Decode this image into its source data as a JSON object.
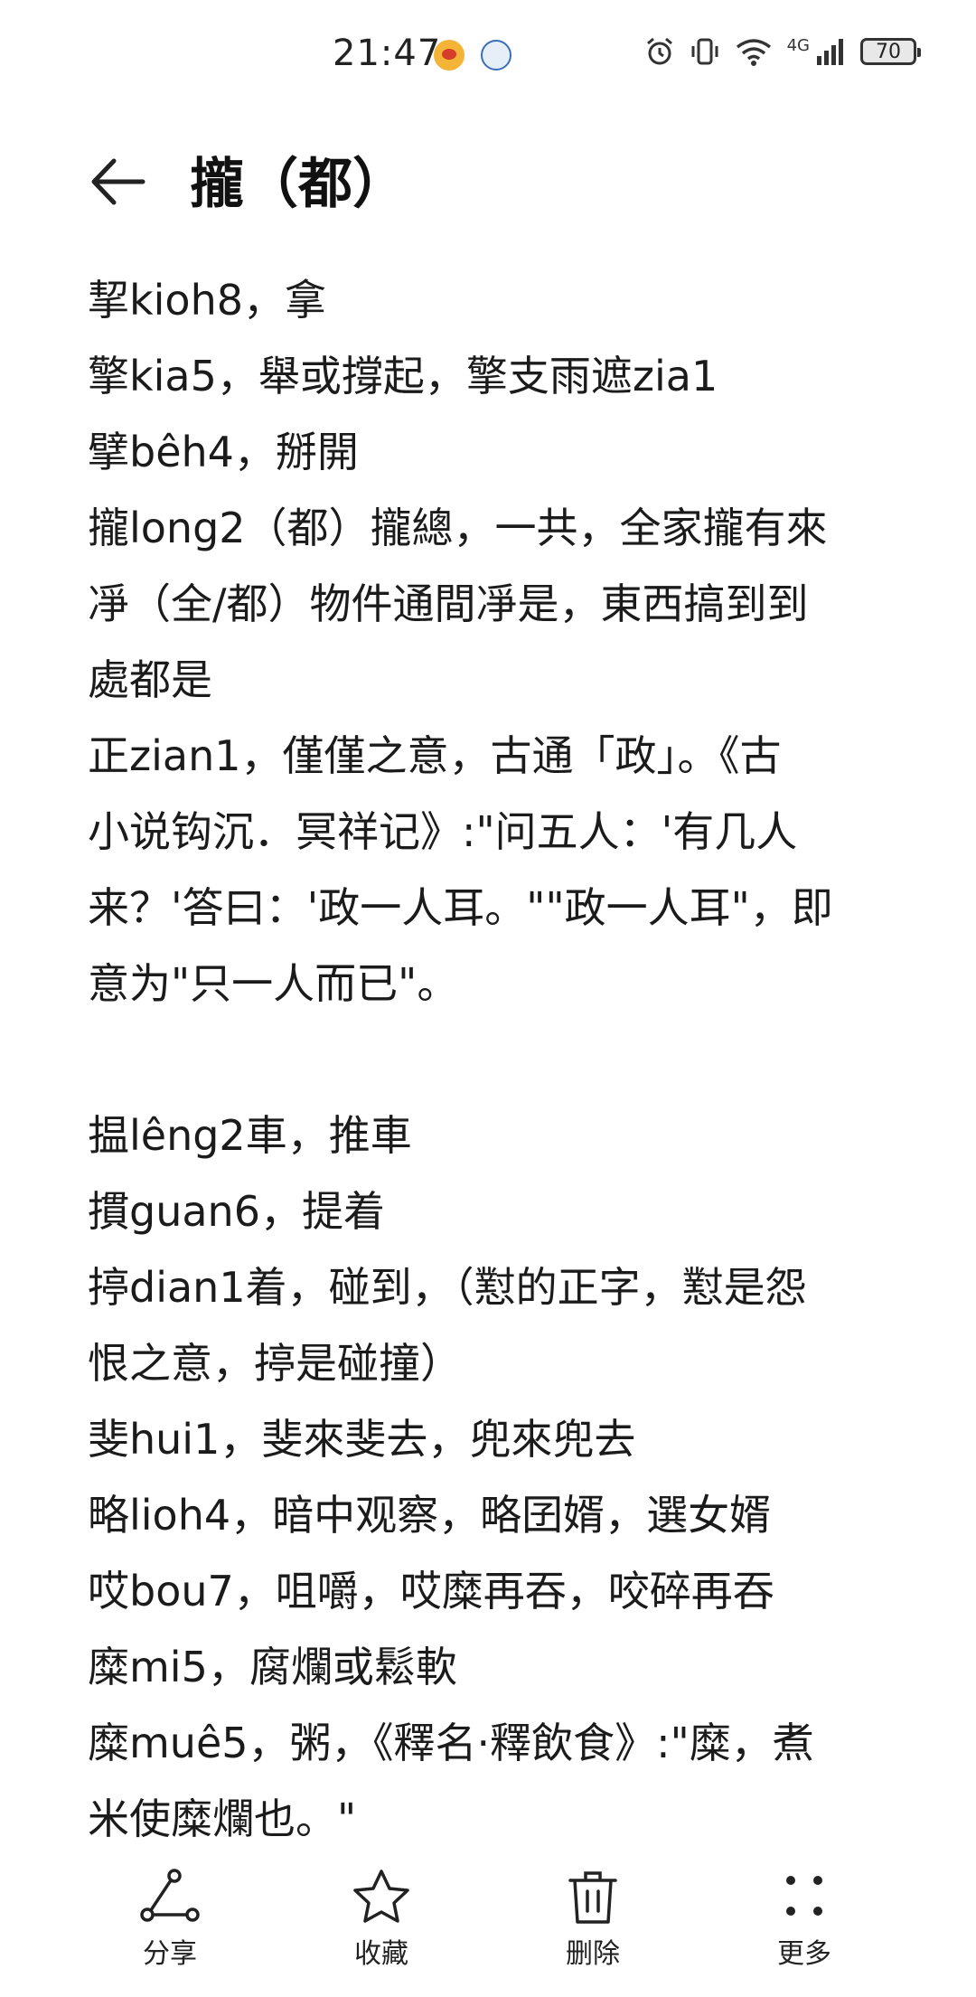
{
  "status_bar": {
    "time": "21:47",
    "battery": "70",
    "network": "4G",
    "icons": [
      "weibo-app-icon",
      "app-notification-icon",
      "alarm-icon",
      "vibrate-icon",
      "wifi-icon",
      "signal-icon",
      "battery-icon"
    ]
  },
  "header": {
    "title": "攏（都）",
    "back_icon": "arrow-left-icon"
  },
  "content": {
    "lines": [
      "挈kioh8，拿",
      "擎kia5，舉或撐起，擎支雨遮zia1",
      "擘bêh4，掰開",
      "攏long2（都）攏總，一共，全家攏有來",
      "凈（全/都）物件通間凈是，東西搞到到",
      "處都是",
      "正zian1，僅僅之意，古通「政」。《古",
      "小说钩沉．冥祥记》:\"问五人：'有几人",
      "来？'答曰：'政一人耳。\"\"政一人耳\"，即",
      "意为\"只一人而已\"。",
      "",
      "揾lêng2車，推車",
      "摜guan6，提着",
      "揨dian1着，碰到，（懟的正字，懟是怨",
      "恨之意，揨是碰撞）",
      "斐hui1，斐來斐去，兜來兜去",
      "略lioh4，暗中观察，略囝婿，選女婿",
      "哎bou7，咀嚼，哎糜再吞，咬碎再吞",
      "糜mi5，腐爛或鬆軟",
      "糜muê5，粥，《釋名·釋飲食》:\"糜，煮",
      "米使糜爛也。\""
    ]
  },
  "bottom_bar": {
    "share_label": "分享",
    "favorite_label": "收藏",
    "delete_label": "删除",
    "more_label": "更多"
  }
}
